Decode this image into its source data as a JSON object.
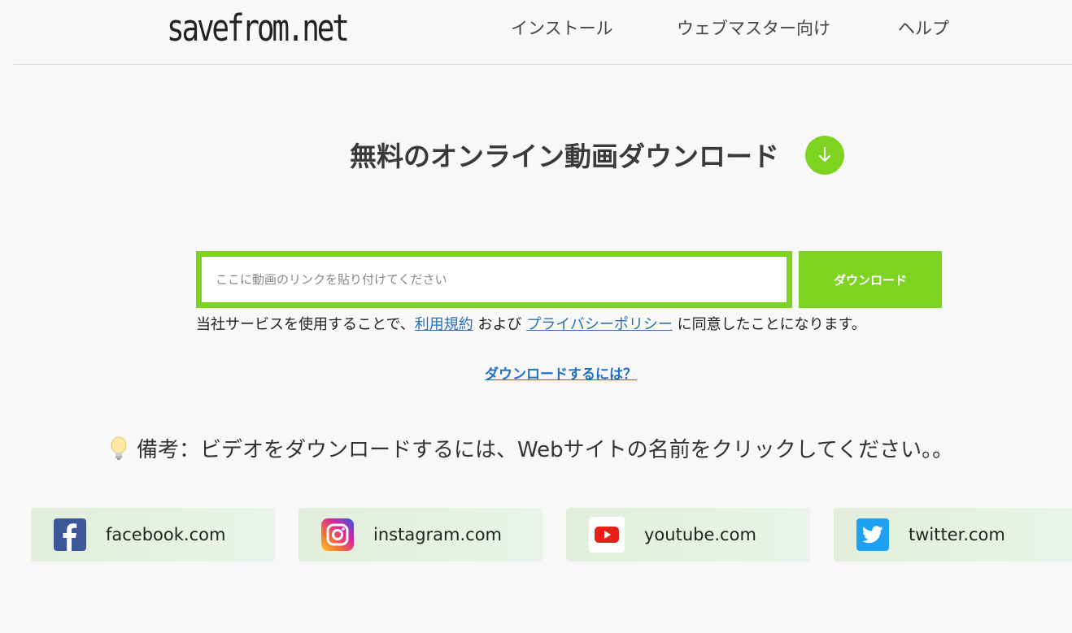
{
  "header": {
    "logo": "savefrom.net",
    "nav": [
      "インストール",
      "ウェブマスター向け",
      "ヘルプ"
    ]
  },
  "hero": {
    "title": "無料のオンライン動画ダウンロード",
    "badge_icon": "arrow-down-icon"
  },
  "form": {
    "url_placeholder": "ここに動画のリンクを貼り付けてください",
    "url_value": "",
    "button_label": "ダウンロード"
  },
  "terms": {
    "prefix": "当社サービスを使用することで、",
    "tos_link": "利用規約",
    "middle": " および ",
    "privacy_link": "プライバシーポリシー",
    "suffix": " に同意したことになります。"
  },
  "howto_link": "ダウンロードするには？",
  "note": {
    "icon": "lightbulb-icon",
    "text": "備考：ビデオをダウンロードするには、Webサイトの名前をクリックしてください。。"
  },
  "sites": [
    {
      "name": "facebook.com",
      "icon": "facebook-icon",
      "color": "#3b5998"
    },
    {
      "name": "instagram.com",
      "icon": "instagram-icon",
      "color": "#d6249f"
    },
    {
      "name": "youtube.com",
      "icon": "youtube-icon",
      "color": "#e62117"
    },
    {
      "name": "twitter.com",
      "icon": "twitter-icon",
      "color": "#1da1f2"
    }
  ],
  "colors": {
    "accent": "#7ed321",
    "link": "#2a6fb5",
    "background": "#f8f8f8"
  }
}
